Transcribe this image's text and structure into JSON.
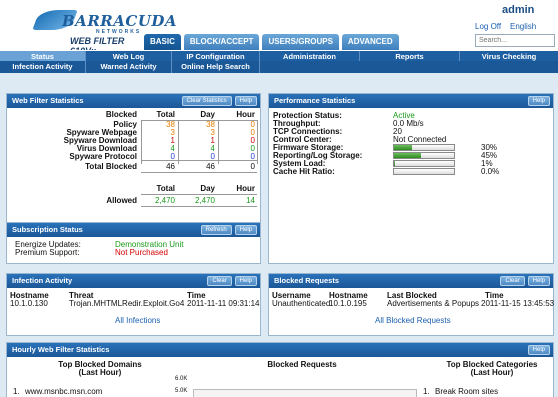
{
  "header": {
    "brand": "BARRACUDA",
    "brand_sub": "NETWORKS",
    "model": "WEB FILTER 610Vx",
    "user": "admin",
    "logoff": "Log Off",
    "language": "English",
    "search_placeholder": "Search..."
  },
  "tabs": [
    "BASIC",
    "BLOCK/ACCEPT",
    "USERS/GROUPS",
    "ADVANCED"
  ],
  "nav1": [
    "Status",
    "Web Log",
    "IP Configuration",
    "Administration",
    "Reports",
    "Virus Checking"
  ],
  "nav2": [
    "Infection Activity",
    "Warned Activity",
    "Online Help Search"
  ],
  "wfs": {
    "title": "Web Filter Statistics",
    "btn_clear": "Clear Statistics",
    "btn_help": "Help",
    "cols": [
      "Blocked",
      "Total",
      "Day",
      "Hour"
    ],
    "rows": [
      {
        "label": "Policy",
        "total": "38",
        "day": "38",
        "hour": "0"
      },
      {
        "label": "Spyware Webpage",
        "total": "3",
        "day": "3",
        "hour": "0"
      },
      {
        "label": "Spyware Download",
        "total": "1",
        "day": "1",
        "hour": "0"
      },
      {
        "label": "Virus Download",
        "total": "4",
        "day": "4",
        "hour": "0"
      },
      {
        "label": "Spyware Protocol",
        "total": "0",
        "day": "0",
        "hour": "0"
      }
    ],
    "total_label": "Total Blocked",
    "total": {
      "total": "46",
      "day": "46",
      "hour": "0"
    },
    "cols2": [
      "Total",
      "Day",
      "Hour"
    ],
    "allowed_label": "Allowed",
    "allowed": {
      "total": "2,470",
      "day": "2,470",
      "hour": "14"
    }
  },
  "perf": {
    "title": "Performance Statistics",
    "btn_help": "Help",
    "rows": [
      {
        "label": "Protection Status:",
        "value": "Active"
      },
      {
        "label": "Throughput:",
        "value": "0.0 Mb/s"
      },
      {
        "label": "TCP Connections:",
        "value": "20"
      },
      {
        "label": "Control Center:",
        "value": "Not Connected"
      }
    ],
    "bars": [
      {
        "label": "Firmware Storage:",
        "value": "30%",
        "level": 0.3
      },
      {
        "label": "Reporting/Log Storage:",
        "value": "45%",
        "level": 0.45
      },
      {
        "label": "System Load:",
        "value": "1%",
        "level": 0.01
      },
      {
        "label": "Cache Hit Ratio:",
        "value": "0.0%",
        "level": 0.0
      }
    ]
  },
  "sub": {
    "title": "Subscription Status",
    "btn_refresh": "Refresh",
    "btn_help": "Help",
    "energize_label": "Energize Updates:",
    "energize_value": "Demonstration Unit",
    "premium_label": "Premium Support:",
    "premium_value": "Not Purchased"
  },
  "infection": {
    "title": "Infection Activity",
    "btn_clear": "Clear",
    "btn_help": "Help",
    "cols": [
      "Hostname",
      "Threat",
      "Time"
    ],
    "row": {
      "host": "10.1.0.130",
      "threat": "Trojan.MHTMLRedir.Exploit.Go4",
      "time": "2011-11-11 09:31:14"
    },
    "link": "All Infections"
  },
  "blocked": {
    "title": "Blocked Requests",
    "btn_clear": "Clear",
    "btn_help": "Help",
    "cols": [
      "Username",
      "Hostname",
      "Last Blocked",
      "Time"
    ],
    "row": {
      "user": "Unauthenticated",
      "host": "10.1.0.195",
      "last": "Advertisements & Popups",
      "time": "2011-11-15 13:45:53"
    },
    "link": "All Blocked Requests"
  },
  "hourly": {
    "title": "Hourly Web Filter Statistics",
    "btn_help": "Help",
    "domains_title": "Top Blocked Domains",
    "domains_sub": "(Last Hour)",
    "domains": [
      {
        "n": "1.",
        "name": "www.msnbc.msn.com"
      }
    ],
    "chart_title": "Blocked Requests",
    "cat_title": "Top Blocked Categories",
    "cat_sub": "(Last Hour)",
    "categories": [
      {
        "n": "1.",
        "name": "Break Room sites"
      }
    ]
  },
  "chart_data": {
    "type": "bar",
    "title": "Blocked Requests",
    "y_ticks": [
      "6.0K",
      "5.0K"
    ]
  }
}
